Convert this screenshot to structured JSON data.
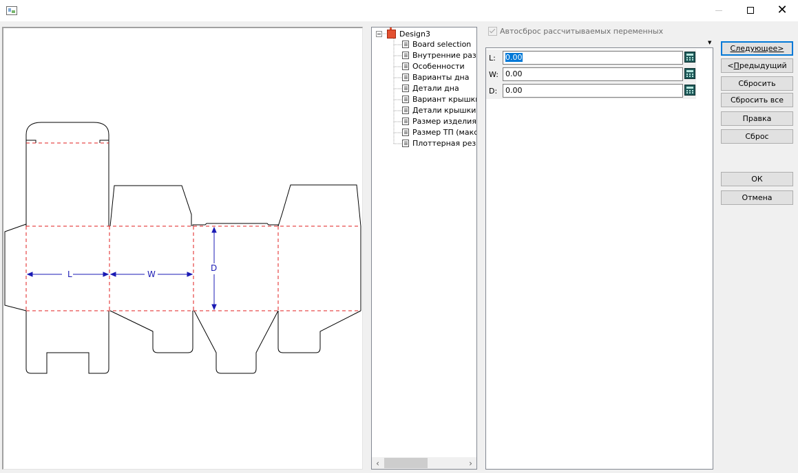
{
  "window": {
    "title": "",
    "minimize_glyph": "—",
    "maximize_glyph": "☐",
    "close_glyph": "✕"
  },
  "diagram": {
    "label_l": "L",
    "label_w": "W",
    "label_d": "D",
    "colors": {
      "outline": "#000000",
      "fold": "#e01e1e",
      "dimension": "#1a1ab4"
    }
  },
  "tree": {
    "root": "Design3",
    "items": [
      {
        "label": "Board selection"
      },
      {
        "label": "Внутренние разме"
      },
      {
        "label": "Особенности"
      },
      {
        "label": "Варианты дна"
      },
      {
        "label": "Детали дна"
      },
      {
        "label": "Вариант крышки"
      },
      {
        "label": "Детали крышки"
      },
      {
        "label": "Размер изделия"
      },
      {
        "label": "Размер ТП (макс Г"
      },
      {
        "label": "Плоттерная резка"
      }
    ],
    "scroll_left": "‹",
    "scroll_right": "›"
  },
  "options": {
    "autoreset_label": "Автосброс рассчитываемых переменных",
    "autoreset_checked": true
  },
  "variables": [
    {
      "name": "L:",
      "value": "0.00",
      "selected": true
    },
    {
      "name": "W:",
      "value": "0.00",
      "selected": false
    },
    {
      "name": "D:",
      "value": "0.00",
      "selected": false
    }
  ],
  "buttons": {
    "next": "Следующее>",
    "prev_prefix": "<",
    "prev_underlined": "П",
    "prev_rest": "редыдущий",
    "reset": "Сбросить",
    "reset_all": "Сбросить все",
    "edit": "Правка",
    "clear": "Сброс",
    "ok": "ОК",
    "cancel": "Отмена"
  },
  "colors": {
    "accent": "#0078d7",
    "selection": "#0078d7"
  }
}
